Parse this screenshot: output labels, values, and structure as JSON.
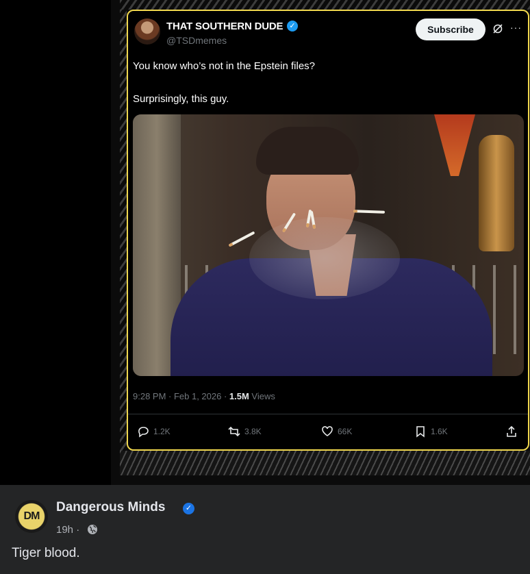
{
  "tweet": {
    "author_name": "THAT SOUTHERN DUDE",
    "author_handle": "@TSDmemes",
    "verified_glyph": "✓",
    "subscribe_label": "Subscribe",
    "more_glyph": "···",
    "text_line1": "You know who’s not in the Epstein files?",
    "text_line2": "Surprisingly, this guy.",
    "timestamp": "9:28 PM · Feb 1, 2026 · ",
    "views_count": "1.5M",
    "views_label": " Views",
    "actions": {
      "replies": "1.2K",
      "reposts": "3.8K",
      "likes": "66K",
      "bookmarks": "1.6K"
    },
    "border_color": "#f1d84e"
  },
  "post": {
    "page_name": "Dangerous Minds",
    "page_avatar_text": "DM",
    "verified_glyph": "✓",
    "time": "19h ·",
    "caption": "Tiger blood."
  },
  "icons": [
    "verified-icon",
    "grok-icon",
    "more-icon",
    "reply-icon",
    "repost-icon",
    "like-icon",
    "bookmark-icon",
    "share-icon",
    "globe-icon"
  ]
}
